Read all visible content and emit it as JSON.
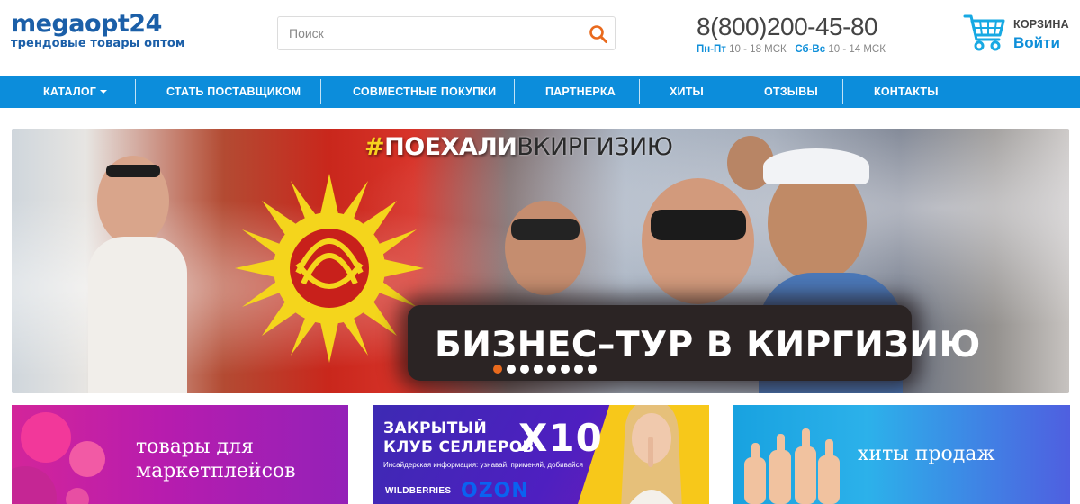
{
  "logo": {
    "mega": "mega",
    "opt": "opt24",
    "tagline": "трендовые товары оптом"
  },
  "search": {
    "placeholder": "Поиск",
    "icon": "search-icon"
  },
  "contact": {
    "phone": "8(800)200-45-80",
    "weekday_label": "Пн-Пт",
    "weekday_hours": "10 - 18 МСК",
    "weekend_label": "Сб-Вс",
    "weekend_hours": "10 - 14 МСК"
  },
  "cart": {
    "label": "КОРЗИНА",
    "login": "Войти",
    "icon": "cart-icon"
  },
  "nav": {
    "items": [
      {
        "label": "КАТАЛОГ"
      },
      {
        "label": "СТАТЬ ПОСТАВЩИКОМ"
      },
      {
        "label": "СОВМЕСТНЫЕ ПОКУПКИ"
      },
      {
        "label": "ПАРТНЕРКА"
      },
      {
        "label": "ХИТЫ"
      },
      {
        "label": "ОТЗЫВЫ"
      },
      {
        "label": "КОНТАКТЫ"
      }
    ]
  },
  "hero": {
    "hash": "#",
    "hashtag_bold": "ПОЕХАЛИ",
    "hashtag_thin": "ВКИРГИЗИЮ",
    "title": "БИЗНЕС–ТУР В КИРГИЗИЮ",
    "slides_total": 8,
    "active_slide": 1
  },
  "tiles": [
    {
      "line1": "товары для",
      "line2": "маркетплейсов"
    },
    {
      "title_line1": "ЗАКРЫТЫЙ",
      "title_line2": "КЛУБ СЕЛЛЕРОВ",
      "badge": "X10",
      "subtitle": "Инсайдерская информация: узнавай, применяй, добивайся",
      "brand1": "WILDBERRIES",
      "brand2": "OZON"
    },
    {
      "line1": "хиты продаж"
    }
  ],
  "colors": {
    "brand_blue": "#1b5fa8",
    "nav_blue": "#0c8ddb",
    "accent_blue": "#0f8fd9",
    "search_orange": "#e96a1d"
  }
}
